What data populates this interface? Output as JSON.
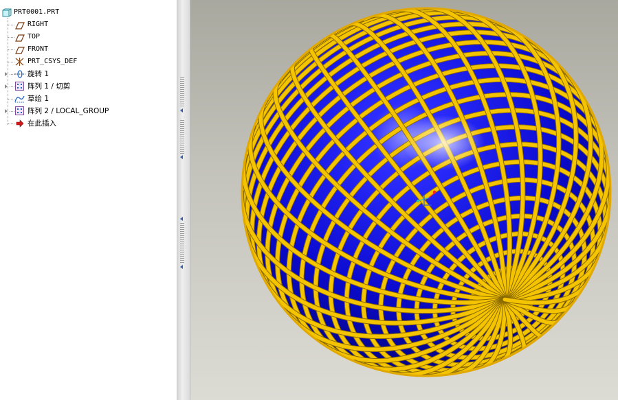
{
  "model_tree": {
    "root": {
      "label": "PRT0001.PRT",
      "icon": "part-icon"
    },
    "items": [
      {
        "label": "RIGHT",
        "icon": "datum-plane-icon"
      },
      {
        "label": "TOP",
        "icon": "datum-plane-icon"
      },
      {
        "label": "FRONT",
        "icon": "datum-plane-icon"
      },
      {
        "label": "PRT_CSYS_DEF",
        "icon": "csys-icon"
      },
      {
        "label": "旋转 1",
        "icon": "revolve-icon"
      },
      {
        "label": "阵列 1 / 切剪",
        "icon": "pattern-icon"
      },
      {
        "label": "草绘 1",
        "icon": "sketch-icon"
      },
      {
        "label": "阵列 2 / LOCAL_GROUP",
        "icon": "pattern-icon"
      },
      {
        "label": "在此插入",
        "icon": "insert-here-arrow-icon"
      }
    ]
  },
  "viewport": {
    "model": "sphere-with-grid-ribs",
    "colors": {
      "sphere": "#1010d8",
      "ribs": "#f5c400",
      "background_top": "#a9a89f",
      "background_bottom": "#dcdbd4"
    }
  }
}
